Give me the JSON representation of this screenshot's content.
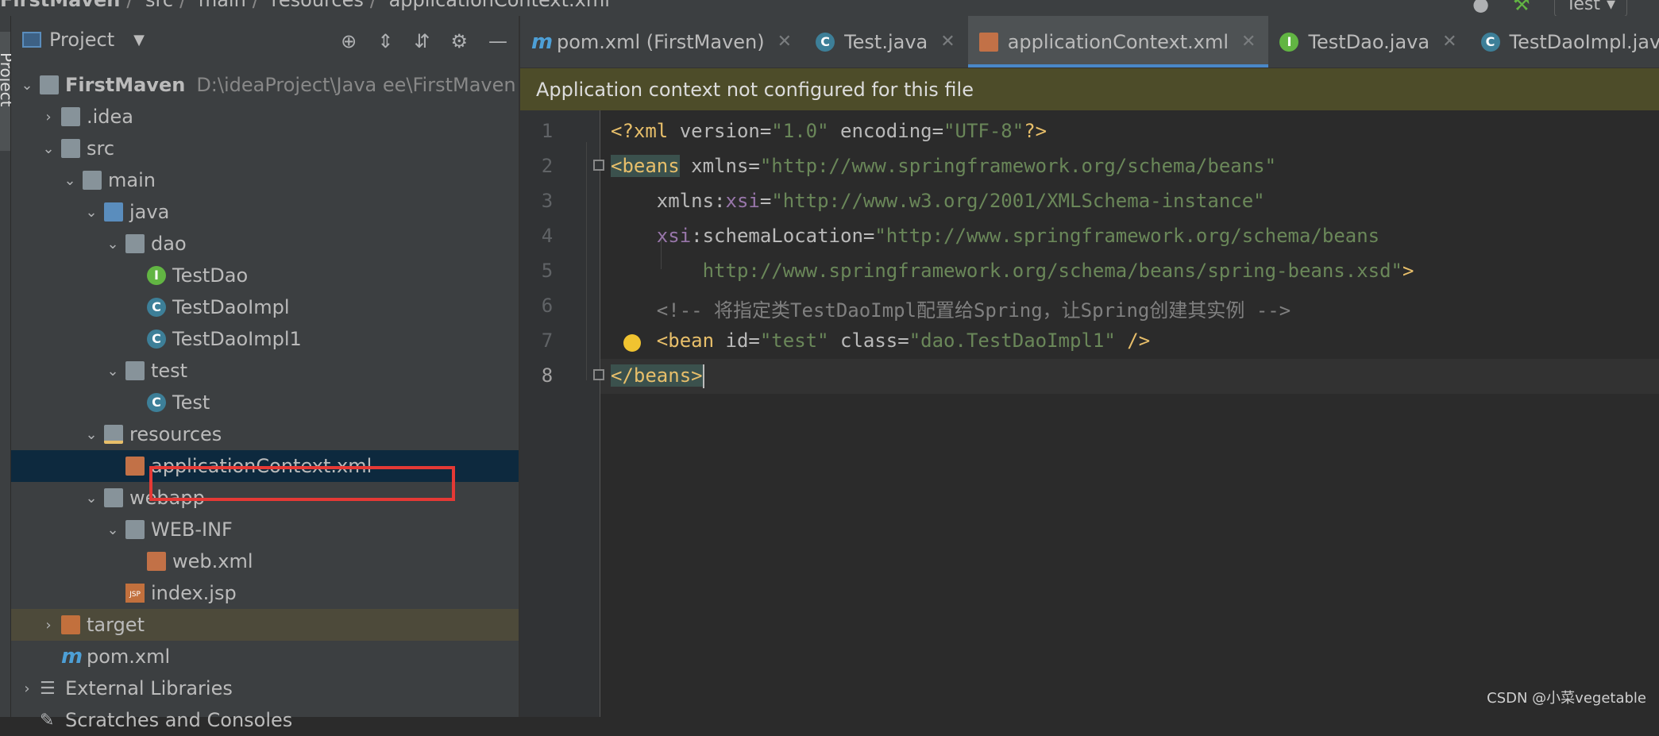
{
  "breadcrumbs": [
    "FirstMaven",
    "src",
    "main",
    "resources",
    "applicationContext.xml"
  ],
  "run_config": "Test",
  "side_strip_label": "Project",
  "panel": {
    "title": "Project",
    "tools": [
      "target-icon",
      "expand-all-icon",
      "collapse-all-icon",
      "gear-icon",
      "minimize-icon"
    ]
  },
  "tree": [
    {
      "label": "FirstMaven",
      "path": "D:\\ideaProject\\Java ee\\FirstMaven",
      "level": 0,
      "arrow": "v",
      "icon": "module-folder"
    },
    {
      "label": ".idea",
      "level": 1,
      "arrow": ">",
      "icon": "folder"
    },
    {
      "label": "src",
      "level": 1,
      "arrow": "v",
      "icon": "folder"
    },
    {
      "label": "main",
      "level": 2,
      "arrow": "v",
      "icon": "folder"
    },
    {
      "label": "java",
      "level": 3,
      "arrow": "v",
      "icon": "folder-blue"
    },
    {
      "label": "dao",
      "level": 4,
      "arrow": "v",
      "icon": "package"
    },
    {
      "label": "TestDao",
      "level": 5,
      "icon": "interface"
    },
    {
      "label": "TestDaoImpl",
      "level": 5,
      "icon": "class"
    },
    {
      "label": "TestDaoImpl1",
      "level": 5,
      "icon": "class"
    },
    {
      "label": "test",
      "level": 4,
      "arrow": "v",
      "icon": "package"
    },
    {
      "label": "Test",
      "level": 5,
      "icon": "class-run"
    },
    {
      "label": "resources",
      "level": 3,
      "arrow": "v",
      "icon": "folder-resources"
    },
    {
      "label": "applicationContext.xml",
      "level": 4,
      "icon": "spring-xml",
      "selected": true
    },
    {
      "label": "webapp",
      "level": 3,
      "arrow": "v",
      "icon": "folder-web"
    },
    {
      "label": "WEB-INF",
      "level": 4,
      "arrow": "v",
      "icon": "folder"
    },
    {
      "label": "web.xml",
      "level": 5,
      "icon": "web-xml"
    },
    {
      "label": "index.jsp",
      "level": 4,
      "icon": "jsp"
    },
    {
      "label": "target",
      "level": 1,
      "arrow": ">",
      "icon": "folder-orange",
      "excluded": true
    },
    {
      "label": "pom.xml",
      "level": 1,
      "icon": "maven"
    },
    {
      "label": "External Libraries",
      "level": 0,
      "arrow": ">",
      "icon": "libraries"
    },
    {
      "label": "Scratches and Consoles",
      "level": 0,
      "icon": "scratches"
    }
  ],
  "tabs": [
    {
      "label": "pom.xml (FirstMaven)",
      "icon": "maven",
      "active": false
    },
    {
      "label": "Test.java",
      "icon": "class-run",
      "active": false
    },
    {
      "label": "applicationContext.xml",
      "icon": "spring-xml",
      "active": true
    },
    {
      "label": "TestDao.java",
      "icon": "interface",
      "active": false
    },
    {
      "label": "TestDaoImpl.java",
      "icon": "class",
      "active": false
    }
  ],
  "banner": "Application context not configured for this file",
  "code": {
    "line_numbers": [
      "1",
      "2",
      "3",
      "4",
      "5",
      "6",
      "7",
      "8"
    ],
    "l1_open": "<?xml ",
    "l1_a1": "version=",
    "l1_v1": "\"1.0\"",
    "l1_a2": " encoding=",
    "l1_v2": "\"UTF-8\"",
    "l1_close": "?>",
    "l2_tag": "<beans",
    "l2_attr": " xmlns=",
    "l2_val": "\"http://www.springframework.org/schema/beans\"",
    "l3_attr": "    xmlns:",
    "l3_ns": "xsi",
    "l3_eq": "=",
    "l3_val": "\"http://www.w3.org/2001/XMLSchema-instance\"",
    "l4_ns": "    xsi",
    "l4_attr": ":schemaLocation=",
    "l4_val": "\"http://www.springframework.org/schema/beans",
    "l5_val": "        http://www.springframework.org/schema/beans/spring-beans.xsd\"",
    "l5_close": ">",
    "l6_comment": "    <!-- 将指定类TestDaoImpl配置给Spring，让Spring创建其实例 -->",
    "l7_tag": "    <bean",
    "l7_a1": " id=",
    "l7_v1": "\"test\"",
    "l7_a2": " class=",
    "l7_v2": "\"dao.TestDaoImpl1\"",
    "l7_close": " />",
    "l8_tag": "</beans>"
  },
  "watermark": "CSDN @小菜vegetable"
}
